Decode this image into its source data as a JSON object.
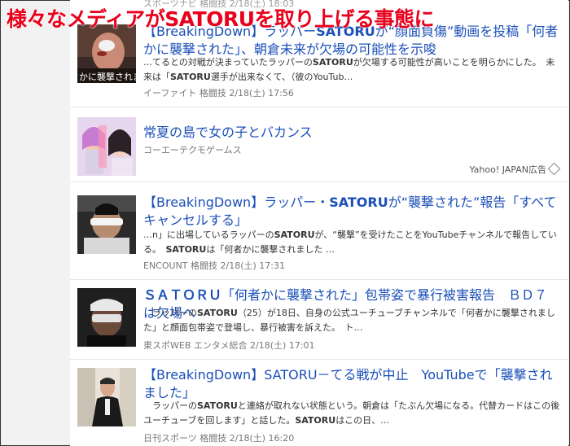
{
  "overlay": {
    "headline": "様々なメディアがSATORUを取り上げる事態に"
  },
  "top_meta": "スポーツナビ 格闘技 2/18(土) 18:03",
  "articles": [
    {
      "title_pre": "【BreakingDown】ラッパー",
      "title_keyword": "SATORU",
      "title_post": "が“顔面負傷”動画を投稿「何者かに襲撃された」、朝倉未来が欠場の可能性を示唆",
      "thumb_caption": "かに襲撃されまし",
      "snippet_1": "…てるとの対戦が決まっていたラッパーの",
      "snippet_keyword_1": "SATORU",
      "snippet_2": "が欠場する可能性が高いことを明らかにした。　未来は「",
      "snippet_keyword_2": "SATORU",
      "snippet_3": "選手が出来なくて、（彼のYouTub…",
      "meta": "イーファイト 格闘技 2/18(土) 17:56"
    },
    {
      "title": "常夏の島で女の子とバカンス",
      "advertiser": "コーエーテクモゲームス",
      "sponsor_label": "Yahoo! JAPAN広告"
    },
    {
      "title_pre": "【BreakingDown】ラッパー・",
      "title_keyword": "SATORU",
      "title_post": "が“襲撃された”報告「すべてキャンセルする」",
      "snippet_1": "…n」に出場しているラッパーの",
      "snippet_keyword_1": "SATORU",
      "snippet_2": "が、“襲撃”を受けたことをYouTubeチャンネルで報告している。　",
      "snippet_keyword_2": "SATORU",
      "snippet_3": "は「何者かに襲撃されました …",
      "meta": "ENCOUNT 格闘技 2/18(土) 17:31"
    },
    {
      "title_keyword": "ＳＡＴＯＲＵ",
      "title_post": "「何者かに襲撃された」包帯姿で暴行被害報告　ＢＤ７は欠場へ",
      "snippet_1": "　ラッパーの",
      "snippet_keyword_1": "SATORU",
      "snippet_2": "（25）が18日、自身の公式ユーチューブチャンネルで「何者かに襲撃されました」と顔面包帯姿で登場し、暴行被害を訴えた。　ト…",
      "meta": "東スポWEB エンタメ総合 2/18(土) 17:01"
    },
    {
      "title_pre": "【BreakingDown】SATORU－てる戦が中止　YouTubeで「襲撃されました」",
      "snippet_1": "　ラッパーの",
      "snippet_keyword_1": "SATORU",
      "snippet_2": "と連絡が取れない状態という。朝倉は「たぶん欠場になる。代替カードはこの後ユーチューブを回します」と話した。",
      "snippet_keyword_2": "SATORU",
      "snippet_3": "はこの日、…",
      "meta": "日刊スポーツ 格闘技 2/18(土) 16:20"
    }
  ],
  "colors": {
    "link": "#1a4fb8",
    "overlay_red": "#e8001c",
    "meta_gray": "#777777"
  }
}
